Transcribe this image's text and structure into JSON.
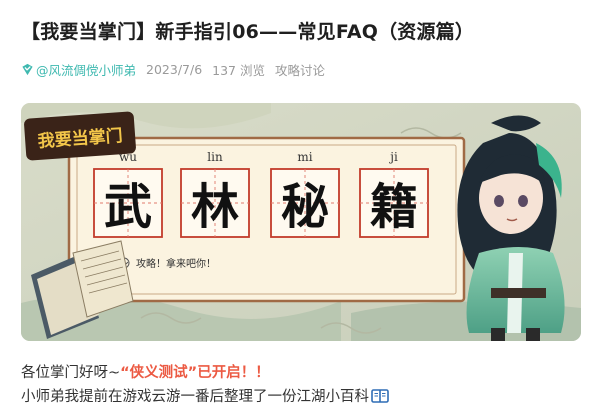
{
  "article": {
    "title": "【我要当掌门】新手指引06——常见FAQ（资源篇）",
    "author": "@风流倜傥小师弟",
    "date": "2023/7/6",
    "views": "137 浏览",
    "category": "攻略讨论"
  },
  "banner": {
    "logo_text": "我要当掌门",
    "pinyin": [
      "wu",
      "lin",
      "mi",
      "ji"
    ],
    "characters": [
      "武",
      "林",
      "秘",
      "籍"
    ],
    "caption": "攻略！拿来吧你！"
  },
  "body": {
    "line1_prefix": "各位掌门好呀~",
    "line1_highlight": "“侠义测试”已开启！！",
    "line2": "小师弟我提前在游戏云游一番后整理了一份江湖小百科"
  },
  "icons": {
    "verified": "verified-badge-icon",
    "book": "open-book-icon"
  },
  "colors": {
    "accent_teal": "#3fb9b0",
    "highlight_red": "#ec5a43"
  }
}
